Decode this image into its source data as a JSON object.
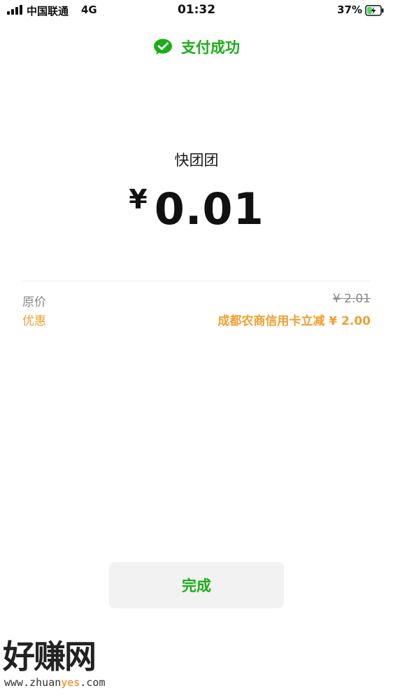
{
  "status_bar": {
    "carrier": "中国联通",
    "network": "4G",
    "time": "01:32",
    "battery_percent": "37%",
    "battery_level": 0.37,
    "battery_charging": true
  },
  "header": {
    "icon": "wechat-icon",
    "title": "支付成功",
    "accent_color": "#1aad19"
  },
  "payment": {
    "merchant": "快团团",
    "currency_symbol": "¥",
    "amount": "0.01"
  },
  "details": {
    "original_price_label": "原价",
    "original_price_value": "¥ 2.01",
    "discount_label": "优惠",
    "discount_value": "成都农商信用卡立减 ¥ 2.00",
    "discount_color": "#f0a030"
  },
  "done_button_label": "完成",
  "watermark": {
    "title": "好赚网",
    "url_prefix": "www.zhuan",
    "url_highlight": "yes",
    "url_suffix": ".com"
  }
}
